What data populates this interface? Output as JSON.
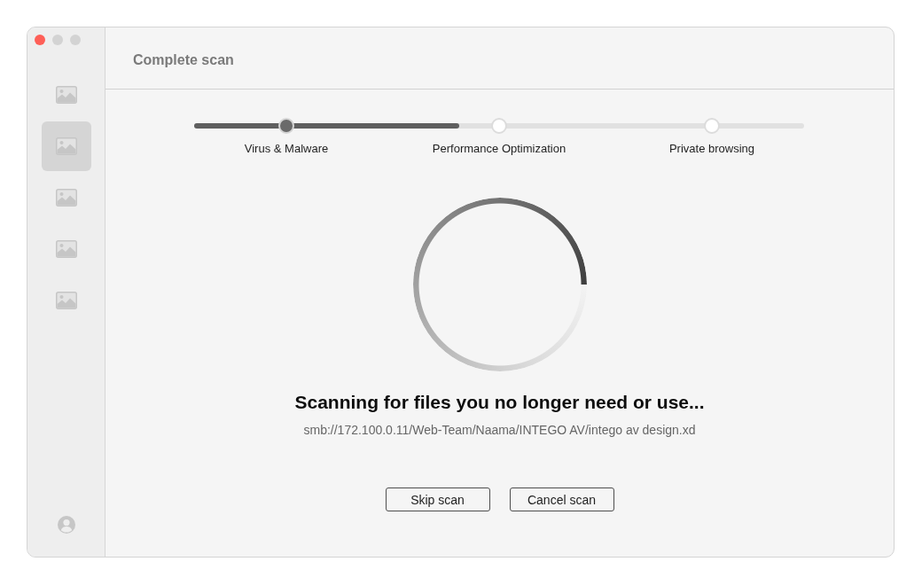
{
  "window": {
    "controls": [
      {
        "kind": "close",
        "disabled": false
      },
      {
        "kind": "minimize",
        "disabled": true
      },
      {
        "kind": "zoom",
        "disabled": true
      }
    ]
  },
  "sidebar": {
    "items": [
      {
        "selected": false
      },
      {
        "selected": true
      },
      {
        "selected": false
      },
      {
        "selected": false
      },
      {
        "selected": false
      }
    ]
  },
  "header": {
    "title": "Complete scan"
  },
  "steps": {
    "level": 0.435,
    "items": [
      {
        "label": "Virus & Malware",
        "done": true
      },
      {
        "label": "Performance Optimization",
        "done": false
      },
      {
        "label": "Private browsing",
        "done": false
      }
    ]
  },
  "status": {
    "heading": "Scanning for files you no longer need or use...",
    "path": "smb://172.100.0.11/Web-Team/Naama/INTEGO AV/intego av design.xd"
  },
  "buttons": [
    {
      "label": "Skip scan"
    },
    {
      "label": "Cancel scan"
    }
  ]
}
